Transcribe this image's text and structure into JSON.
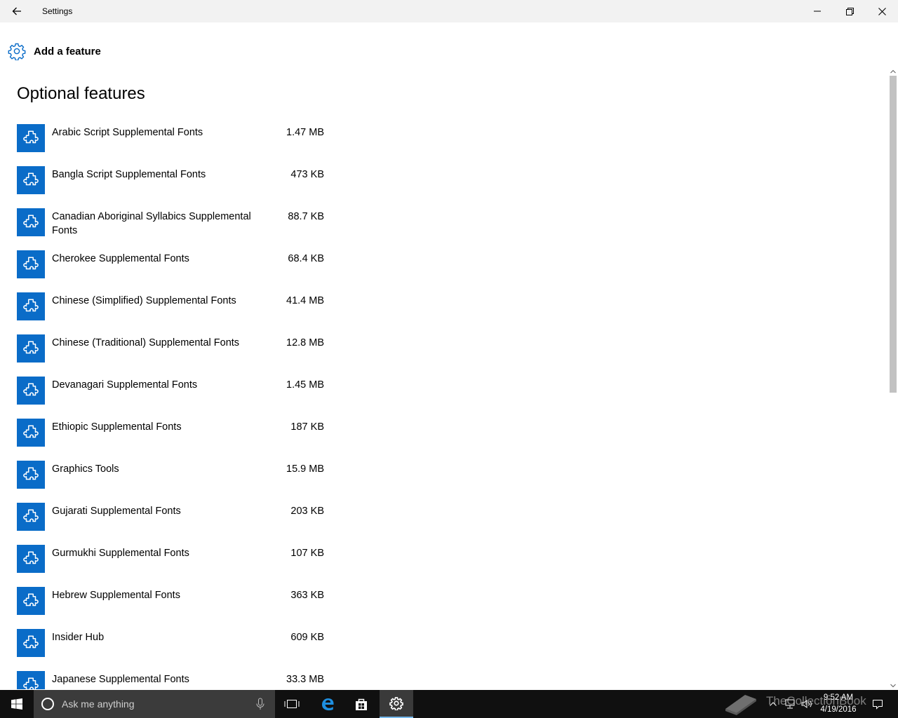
{
  "window": {
    "title": "Settings"
  },
  "add_feature": {
    "label": "Add a feature"
  },
  "section": {
    "title": "Optional features"
  },
  "features": [
    {
      "name": "Arabic Script Supplemental Fonts",
      "size": "1.47 MB"
    },
    {
      "name": "Bangla Script Supplemental Fonts",
      "size": "473 KB"
    },
    {
      "name": "Canadian Aboriginal Syllabics Supplemental Fonts",
      "size": "88.7 KB"
    },
    {
      "name": "Cherokee Supplemental Fonts",
      "size": "68.4 KB"
    },
    {
      "name": "Chinese (Simplified) Supplemental Fonts",
      "size": "41.4 MB"
    },
    {
      "name": "Chinese (Traditional) Supplemental Fonts",
      "size": "12.8 MB"
    },
    {
      "name": "Devanagari Supplemental Fonts",
      "size": "1.45 MB"
    },
    {
      "name": "Ethiopic Supplemental Fonts",
      "size": "187 KB"
    },
    {
      "name": "Graphics Tools",
      "size": "15.9 MB"
    },
    {
      "name": "Gujarati Supplemental Fonts",
      "size": "203 KB"
    },
    {
      "name": "Gurmukhi Supplemental Fonts",
      "size": "107 KB"
    },
    {
      "name": "Hebrew Supplemental Fonts",
      "size": "363 KB"
    },
    {
      "name": "Insider Hub",
      "size": "609 KB"
    },
    {
      "name": "Japanese Supplemental Fonts",
      "size": "33.3 MB"
    }
  ],
  "taskbar": {
    "search_placeholder": "Ask me anything",
    "clock_time": "9:52 AM",
    "clock_date": "4/19/2016"
  },
  "watermark": {
    "text": "TheCollectionBook"
  },
  "colors": {
    "accent": "#0a6cc8",
    "titlebar": "#f2f2f2",
    "taskbar": "#101010"
  }
}
